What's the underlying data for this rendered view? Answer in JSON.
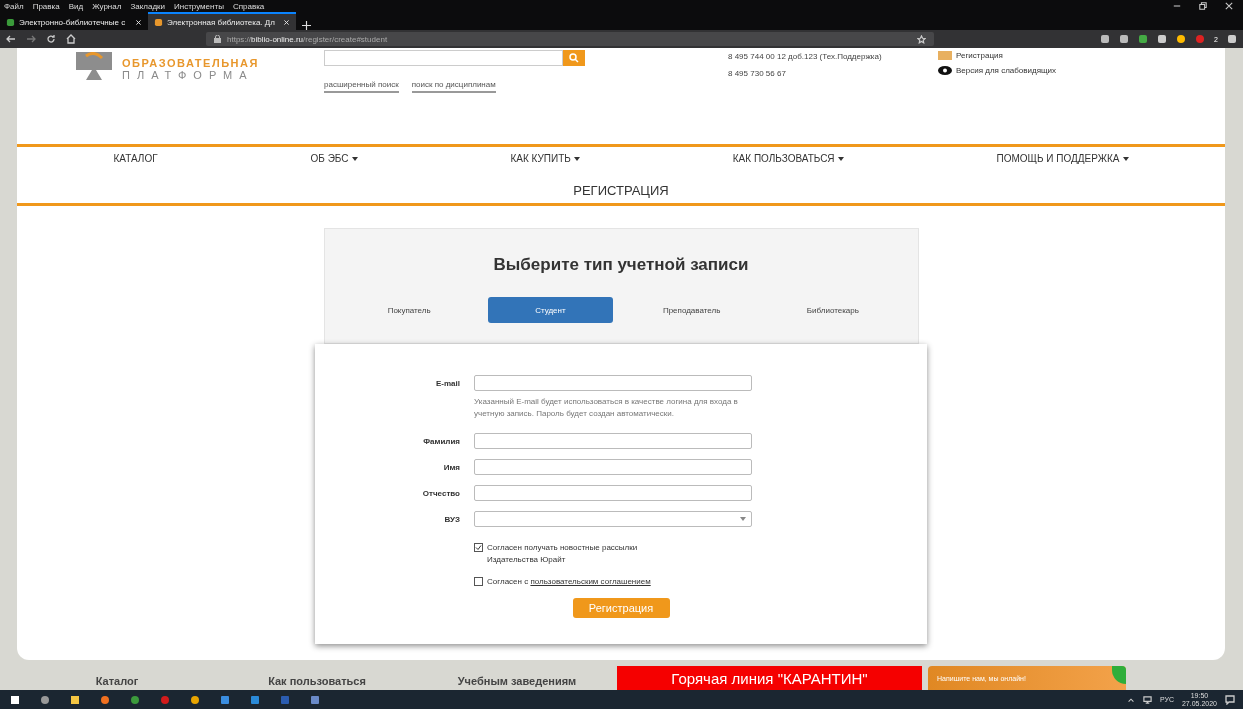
{
  "browser": {
    "menu": [
      "Файл",
      "Правка",
      "Вид",
      "Журнал",
      "Закладки",
      "Инструменты",
      "Справка"
    ],
    "tabs": [
      {
        "title": "Электронно-библиотечные с",
        "selected": false
      },
      {
        "title": "Электронная библиотека. Дл",
        "selected": true
      }
    ],
    "url_host": "https://biblio-online.ru",
    "url_path": "/register/create#student",
    "extension_badge": "2"
  },
  "header": {
    "logo_line1": "ОБРАЗОВАТЕЛЬНАЯ",
    "logo_line2": "ПЛАТФОРМА",
    "search_links": [
      "расширенный поиск",
      "поиск по дисциплинам"
    ],
    "phones": [
      "8 495 744 00 12 доб.123 (Тех.Поддержка)",
      "8 495 730 56 67"
    ],
    "links": [
      "Регистрация",
      "Версия для слабовидящих"
    ]
  },
  "nav": [
    {
      "label": "КАТАЛОГ",
      "dropdown": false
    },
    {
      "label": "ОБ ЭБС",
      "dropdown": true
    },
    {
      "label": "КАК КУПИТЬ",
      "dropdown": true
    },
    {
      "label": "КАК ПОЛЬЗОВАТЬСЯ",
      "dropdown": true
    },
    {
      "label": "ПОМОЩЬ И ПОДДЕРЖКА",
      "dropdown": true
    }
  ],
  "page_title": "РЕГИСТРАЦИЯ",
  "account": {
    "heading": "Выберите тип учетной записи",
    "types": [
      {
        "label": "Покупатель",
        "selected": false
      },
      {
        "label": "Студент",
        "selected": true
      },
      {
        "label": "Преподаватель",
        "selected": false
      },
      {
        "label": "Библиотекарь",
        "selected": false
      }
    ]
  },
  "form": {
    "fields": [
      {
        "label": "E-mail",
        "kind": "text",
        "hint": "Указанный E-mail будет использоваться в качестве логина для входа в учетную запись. Пароль будет создан автоматически."
      },
      {
        "label": "Фамилия",
        "kind": "text"
      },
      {
        "label": "Имя",
        "kind": "text"
      },
      {
        "label": "Отчество",
        "kind": "text"
      },
      {
        "label": "ВУЗ",
        "kind": "select"
      }
    ],
    "checkboxes": [
      {
        "text": "Согласен получать новостные рассылки Издательства Юрайт",
        "checked": true
      },
      {
        "text": "Согласен с ",
        "link": "пользовательским соглашением",
        "checked": false
      }
    ],
    "submit": "Регистрация"
  },
  "footer": {
    "links": [
      "Каталог",
      "Как пользоваться",
      "Учебным заведениям"
    ],
    "hotline": "Горячая линия \"КАРАНТИН\"",
    "chat": "Напишите нам, мы онлайн!"
  },
  "taskbar": {
    "language": "РУС",
    "time": "19:50",
    "date": "27.05.2020"
  }
}
